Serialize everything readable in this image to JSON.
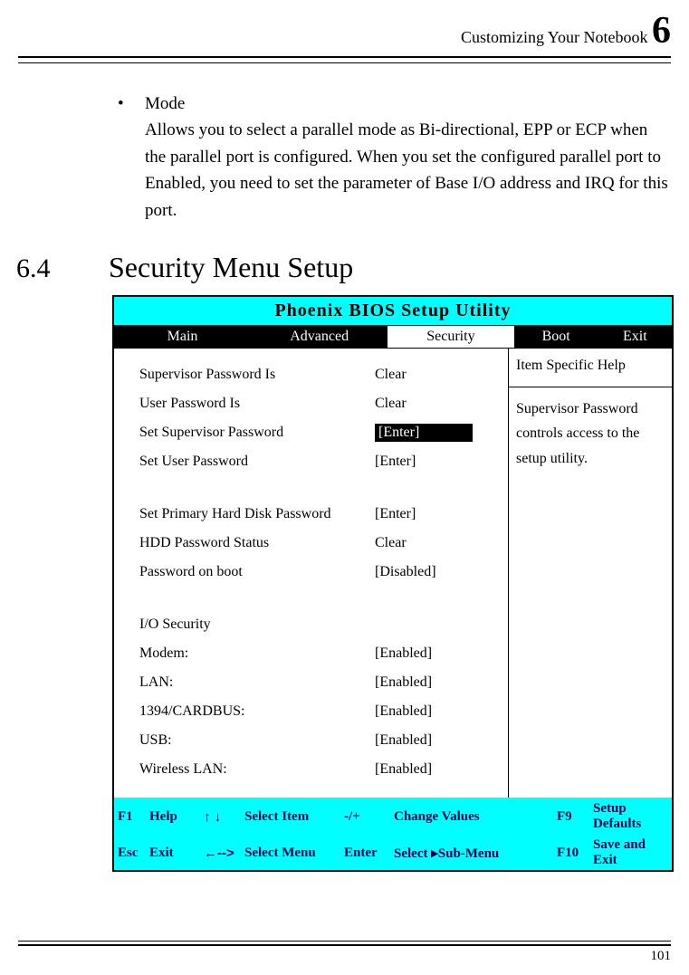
{
  "header": {
    "title": "Customizing Your Notebook",
    "chapter": "6"
  },
  "bullet": {
    "label": "Mode",
    "text": "Allows you to select a parallel mode as Bi-directional, EPP or ECP when the parallel port is configured. When you set the configured parallel port to Enabled, you need to set the parameter of Base I/O address and IRQ for this port."
  },
  "section": {
    "number": "6.4",
    "title": "Security Menu Setup"
  },
  "bios": {
    "title": "Phoenix BIOS Setup Utility",
    "menu": {
      "main": "Main",
      "advanced": "Advanced",
      "security": "Security",
      "boot": "Boot",
      "exit": "Exit"
    },
    "help": {
      "title": "Item Specific Help",
      "body": "Supervisor Password controls access to the setup utility."
    },
    "rows": [
      {
        "label": "Supervisor Password Is",
        "value": "Clear"
      },
      {
        "label": "User Password Is",
        "value": "Clear"
      },
      {
        "label": "Set Supervisor Password",
        "value": "[Enter]",
        "selected": true
      },
      {
        "label": "Set User Password",
        "value": "[Enter]"
      }
    ],
    "rows2": [
      {
        "label": "Set Primary Hard Disk Password",
        "value": "[Enter]"
      },
      {
        "label": "HDD Password Status",
        "value": "Clear"
      },
      {
        "label": "Password on boot",
        "value": "[Disabled]"
      }
    ],
    "io_title": "I/O Security",
    "io_rows": [
      {
        "label": "Modem:",
        "value": "[Enabled]"
      },
      {
        "label": "LAN:",
        "value": "[Enabled]"
      },
      {
        "label": "1394/CARDBUS:",
        "value": "[Enabled]"
      },
      {
        "label": "USB:",
        "value": "[Enabled]"
      },
      {
        "label": "Wireless LAN:",
        "value": "[Enabled]"
      }
    ],
    "keys": {
      "f1": "F1",
      "help": "Help",
      "updown": "↑ ↓",
      "select_item": "Select Item",
      "plusminus": "-/+",
      "change_values": "Change Values",
      "f9": "F9",
      "setup_defaults": "Setup Defaults",
      "esc": "Esc",
      "exit": "Exit",
      "leftright": "←-->",
      "select_menu": "Select Menu",
      "enter": "Enter",
      "select_sub": "Select ▸Sub-Menu",
      "f10": "F10",
      "save_exit": "Save and Exit"
    }
  },
  "pagenum": "101"
}
